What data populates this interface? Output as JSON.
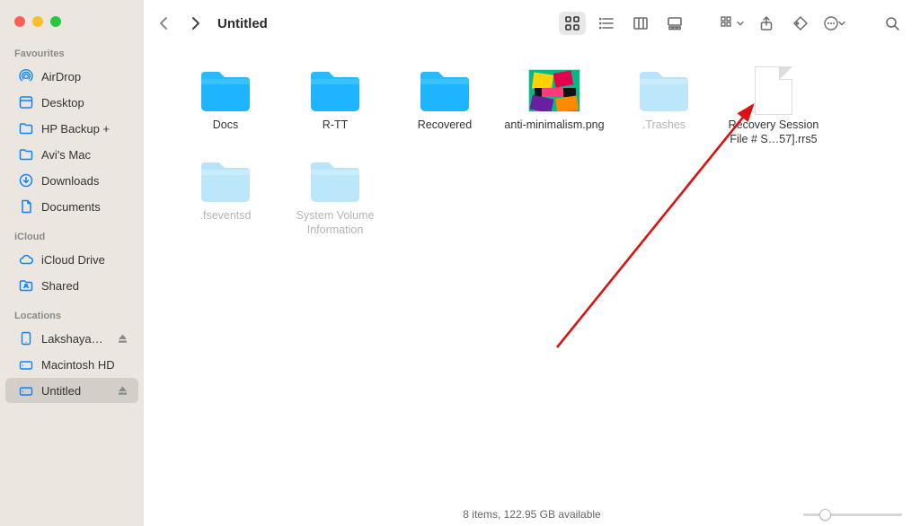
{
  "window_title": "Untitled",
  "sidebar": {
    "sections": [
      {
        "header": "Favourites",
        "items": [
          {
            "icon": "airdrop",
            "label": "AirDrop"
          },
          {
            "icon": "desktop",
            "label": "Desktop"
          },
          {
            "icon": "folder",
            "label": "HP Backup +"
          },
          {
            "icon": "folder",
            "label": "Avi's Mac"
          },
          {
            "icon": "download",
            "label": "Downloads"
          },
          {
            "icon": "document",
            "label": "Documents"
          }
        ]
      },
      {
        "header": "iCloud",
        "items": [
          {
            "icon": "cloud",
            "label": "iCloud Drive"
          },
          {
            "icon": "shared",
            "label": "Shared"
          }
        ]
      },
      {
        "header": "Locations",
        "items": [
          {
            "icon": "ipad",
            "label": "Lakshaya…",
            "eject": true
          },
          {
            "icon": "disk",
            "label": "Macintosh HD"
          },
          {
            "icon": "disk",
            "label": "Untitled",
            "eject": true,
            "selected": true
          }
        ]
      }
    ]
  },
  "toolbar": {
    "view_mode": "icon",
    "buttons": {
      "icon_view": "icon-view",
      "list_view": "list-view",
      "column_view": "column-view",
      "gallery_view": "gallery-view",
      "group": "group",
      "share": "share",
      "tags": "tags",
      "actions": "actions",
      "search": "search"
    }
  },
  "items": [
    {
      "type": "folder",
      "style": "blue",
      "label": "Docs",
      "dim": false,
      "interact": true
    },
    {
      "type": "folder",
      "style": "blue",
      "label": "R-TT",
      "dim": false,
      "interact": true
    },
    {
      "type": "folder",
      "style": "blue",
      "label": "Recovered",
      "dim": false,
      "interact": true
    },
    {
      "type": "image",
      "label": "anti-minimalism.png",
      "dim": false,
      "interact": true
    },
    {
      "type": "folder",
      "style": "dim",
      "label": ".Trashes",
      "dim": true,
      "interact": true
    },
    {
      "type": "file",
      "label": "Recovery Session File # S…57].rrs5",
      "dim": false,
      "interact": true
    },
    {
      "type": "folder",
      "style": "dim",
      "label": ".fseventsd",
      "dim": true,
      "interact": true
    },
    {
      "type": "folder",
      "style": "dim",
      "label": "System Volume Information",
      "dim": true,
      "interact": true
    }
  ],
  "status": {
    "text": "8 items, 122.95 GB available"
  },
  "zoom": {
    "value_pct": 22
  }
}
